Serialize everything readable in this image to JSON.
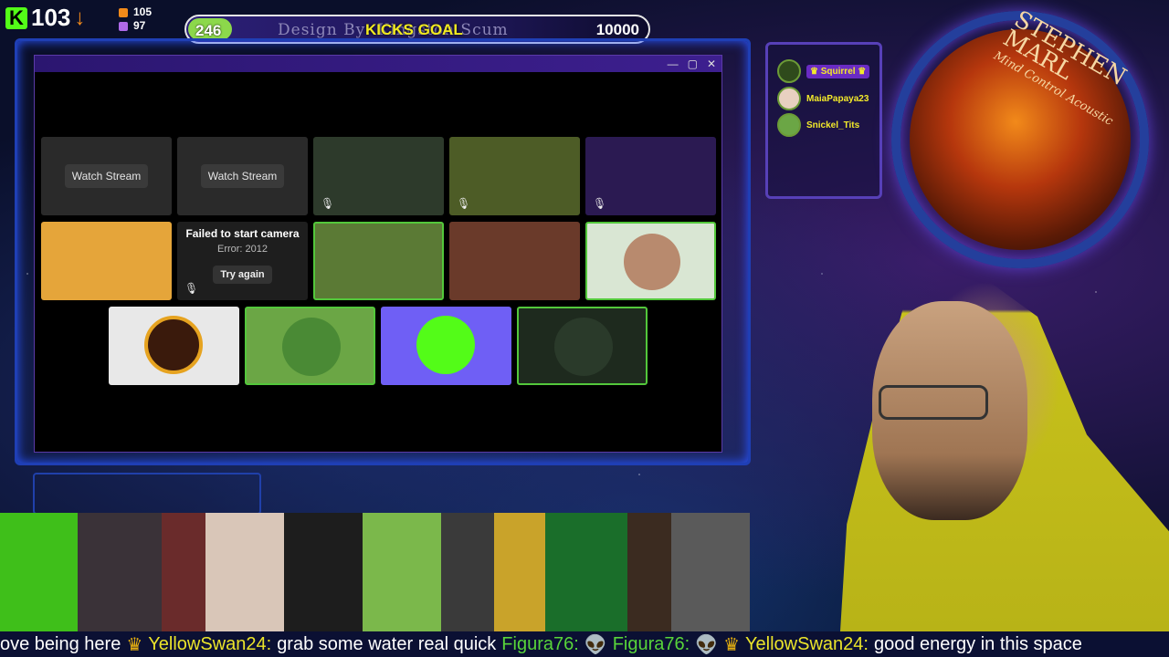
{
  "top_bar": {
    "kick_count": "103",
    "stat_1": "105",
    "stat_2": "97",
    "goal": {
      "current": "246",
      "decoration": "Design By: Kingston Scum",
      "title": "KICKS GOAL",
      "target": "10000",
      "progress": 0.0246
    }
  },
  "window": {
    "controls": [
      "—",
      "▢",
      "✕"
    ],
    "tiles": [
      {
        "type": "placeholder",
        "button": "Watch Stream"
      },
      {
        "type": "placeholder",
        "button": "Watch Stream"
      },
      {
        "type": "video",
        "color": "#2d3a2b"
      },
      {
        "type": "video",
        "color": "#4d5c26"
      },
      {
        "type": "video",
        "color": "#2b1a52"
      },
      {
        "type": "video",
        "color": "#e5a53a"
      },
      {
        "type": "error",
        "title": "Failed to start camera",
        "subtitle": "Error: 2012",
        "button": "Try again"
      },
      {
        "type": "video",
        "color": "#5b7a35"
      },
      {
        "type": "video",
        "color": "#6a3a2a"
      },
      {
        "type": "avatar",
        "color": "#d9e6d3"
      },
      {
        "type": "avatar",
        "color": "#e8e8e8"
      },
      {
        "type": "avatar",
        "color": "#6ba645"
      },
      {
        "type": "avatar",
        "color": "#6f5ff5"
      },
      {
        "type": "avatar",
        "color": "#1e2a1e"
      }
    ]
  },
  "participants": [
    {
      "name": "♛ Squirrel ♛"
    },
    {
      "name": "MaiaPapaya23"
    },
    {
      "name": "Snickel_Tits"
    }
  ],
  "album": {
    "line1": "STEPHEN MARL",
    "line2": "Mind Control Acoustic"
  },
  "bottom_avatars": [
    {
      "color": "#3fbf1a"
    },
    {
      "color": "#3a3238"
    },
    {
      "color": "#6a2b2b"
    },
    {
      "color": "#d9c6b8"
    },
    {
      "color": "#1d1d1d"
    },
    {
      "color": "#7bb84b"
    },
    {
      "color": "#3a3a3a"
    },
    {
      "color": "#c9a32a"
    },
    {
      "color": "#1a6e2a"
    },
    {
      "color": "#3b2b20"
    },
    {
      "color": "#5a5a5a"
    }
  ],
  "ticker": [
    {
      "kind": "msg",
      "text": "ove being here"
    },
    {
      "kind": "crown",
      "text": "♛"
    },
    {
      "kind": "name",
      "text": "YellowSwan24:"
    },
    {
      "kind": "msg",
      "text": "grab some water real quick"
    },
    {
      "kind": "name-green",
      "text": "Figura76:"
    },
    {
      "kind": "msg",
      "text": "👽"
    },
    {
      "kind": "name-green",
      "text": "Figura76:"
    },
    {
      "kind": "msg",
      "text": "👽"
    },
    {
      "kind": "crown",
      "text": "♛"
    },
    {
      "kind": "name",
      "text": "YellowSwan24:"
    },
    {
      "kind": "msg",
      "text": "good energy in this space"
    }
  ]
}
